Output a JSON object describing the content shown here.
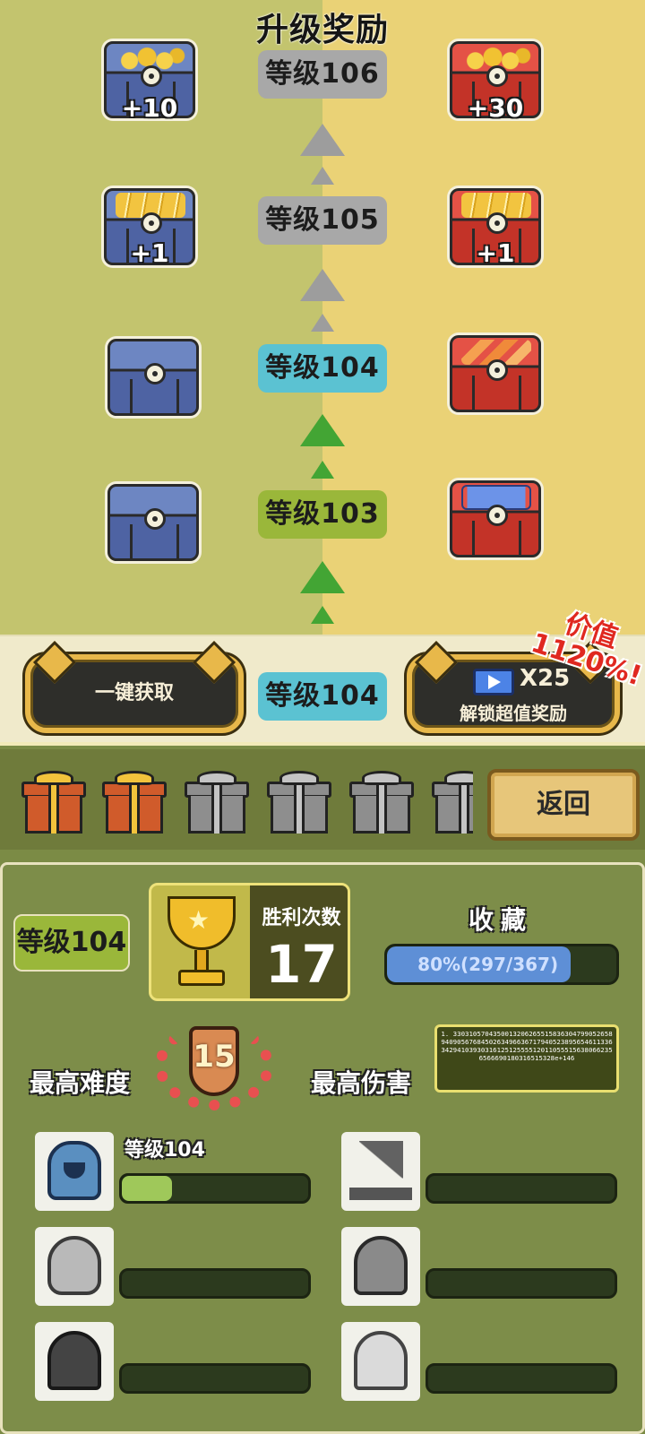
{
  "rewards": {
    "title": "升级奖励",
    "rows": [
      {
        "level": "等级106",
        "free_count": "+10",
        "premium_count": "+30"
      },
      {
        "level": "等级105",
        "free_count": "+1",
        "premium_count": "+1"
      },
      {
        "level": "等级104",
        "free_count": "",
        "premium_count": ""
      },
      {
        "level": "等级103",
        "free_count": "",
        "premium_count": ""
      }
    ],
    "current_level": "等级104",
    "claim_all_label": "一键获取",
    "unlock_multiplier": "X25",
    "unlock_label": "解锁超值奖励",
    "value_tag": "价值1120%!"
  },
  "gifts": {
    "states": [
      "open",
      "open",
      "locked",
      "locked",
      "locked",
      "locked"
    ],
    "back_label": "返回"
  },
  "stats": {
    "level": "等级104",
    "wins_label": "胜利次数",
    "wins_value": "17",
    "collection_label": "收藏",
    "collection_text": "80%(297/367)",
    "collection_progress": 0.8,
    "max_difficulty_label": "最高难度",
    "max_difficulty_value": "15",
    "max_damage_label": "最高伤害",
    "max_damage_value": "1. 3303105704350013206265515836304799052658940905676845026349663671794052389565461133634294103930316125125555120110555156380662356566690180316515328e+146"
  },
  "gear": [
    {
      "icon": "knight-helmet-icon",
      "level": "等级104",
      "progress": 0.27
    },
    {
      "icon": "witch-hat-icon",
      "level": "",
      "progress": 0
    },
    {
      "icon": "turban-helmet-icon",
      "level": "",
      "progress": 0
    },
    {
      "icon": "spiked-helmet-icon",
      "level": "",
      "progress": 0
    },
    {
      "icon": "dark-hood-icon",
      "level": "",
      "progress": 0
    },
    {
      "icon": "floral-veil-icon",
      "level": "",
      "progress": 0
    }
  ],
  "colors": {
    "free_track": "#c3c46e",
    "premium_track": "#ead276",
    "reached_arrow": "#43a534",
    "locked_arrow": "#9d9d9d",
    "current_level_badge": "#5bc2d2",
    "reached_level_badge": "#9ab73a",
    "locked_level_badge": "#a8a8a8"
  }
}
